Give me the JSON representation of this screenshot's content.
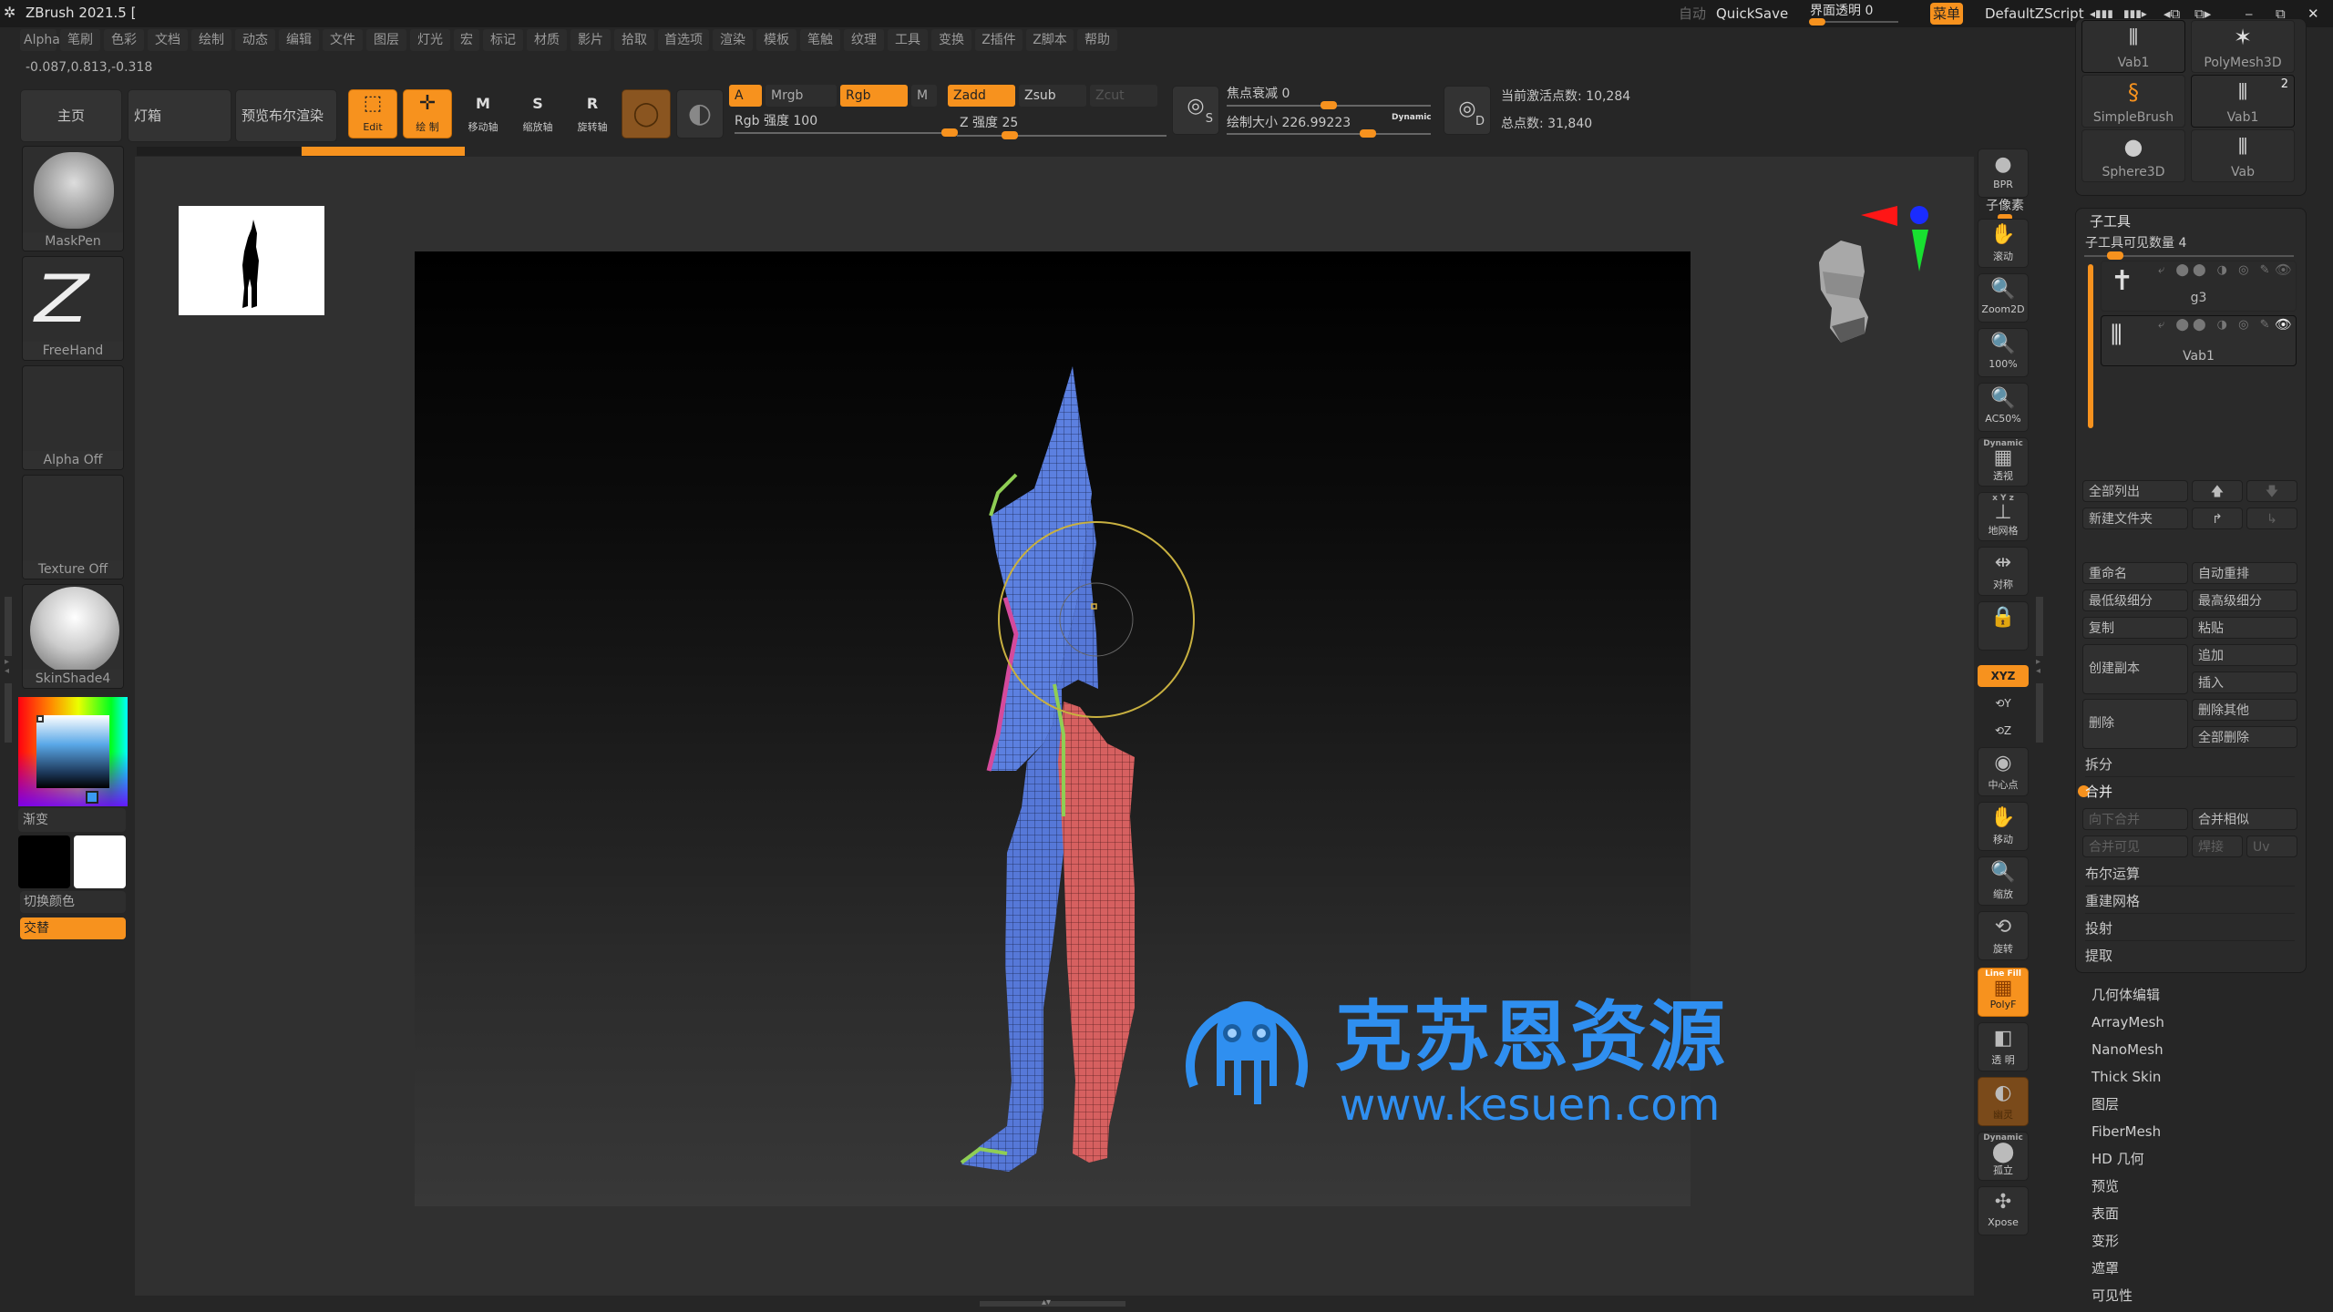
{
  "app": {
    "title": "ZBrush 2021.5 [",
    "auto_label": "自动",
    "quicksave": "QuickSave",
    "transparency_label": "界面透明 0",
    "menu_toggle": "菜单",
    "script_name": "DefaultZScript"
  },
  "menubar": [
    "Alpha",
    "笔刷",
    "色彩",
    "文档",
    "绘制",
    "动态",
    "编辑",
    "文件",
    "图层",
    "灯光",
    "宏",
    "标记",
    "材质",
    "影片",
    "拾取",
    "首选项",
    "渲染",
    "模板",
    "笔触",
    "纹理",
    "工具",
    "变换",
    "Z插件",
    "Z脚本",
    "帮助"
  ],
  "coords": "-0.087,0.813,-0.318",
  "toolbar": {
    "home": "主页",
    "lightbox": "灯箱",
    "bpr_preview": "预览布尔渲染",
    "edit": "Edit",
    "draw": "绘 制",
    "move": "移动轴",
    "scale": "缩放轴",
    "rotate": "旋转轴",
    "move_key": "M",
    "scale_key": "S",
    "rotate_key": "R",
    "a": "A",
    "mrgb": "Mrgb",
    "rgb": "Rgb",
    "m": "M",
    "zadd": "Zadd",
    "zsub": "Zsub",
    "zcut": "Zcut",
    "rgb_intensity": "Rgb 强度 100",
    "rgb_intensity_value": 100,
    "z_intensity": "Z 强度 25",
    "z_intensity_value": 25,
    "focal_shift": "焦点衰减 0",
    "focal_shift_value": 0,
    "draw_size": "绘制大小 226.99223",
    "draw_size_value": 226.99223,
    "dynamic": "Dynamic",
    "s_key": "S",
    "d_key": "D",
    "active_points": "当前激活点数: 10,284",
    "total_points": "总点数: 31,840"
  },
  "left_shelf": {
    "brush": "MaskPen",
    "stroke": "FreeHand",
    "alpha": "Alpha Off",
    "texture": "Texture Off",
    "material": "SkinShade4",
    "gradient": "渐变",
    "switch_color": "切换颜色",
    "alternate": "交替",
    "main_color": "#3a9af0"
  },
  "right_shelf": [
    {
      "name": "bpr",
      "label": "BPR"
    },
    {
      "name": "subpixel",
      "label": "子像素"
    },
    {
      "name": "scroll",
      "label": "滚动"
    },
    {
      "name": "zoom2d",
      "label": "Zoom2D"
    },
    {
      "name": "zoom100",
      "label": "100%"
    },
    {
      "name": "ac50",
      "label": "AC50%"
    },
    {
      "name": "perspective",
      "label": "透视",
      "sup": "Dynamic"
    },
    {
      "name": "floor",
      "label": "地网格",
      "sup": "x Y z"
    },
    {
      "name": "symmetry",
      "label": "对称"
    },
    {
      "name": "camera-lock",
      "label": ""
    },
    {
      "name": "xyz",
      "label": "XYZ"
    },
    {
      "name": "y",
      "label": "Y"
    },
    {
      "name": "z",
      "label": "Z"
    },
    {
      "name": "center",
      "label": "中心点"
    },
    {
      "name": "move",
      "label": "移动"
    },
    {
      "name": "zoom",
      "label": "缩放"
    },
    {
      "name": "rotate",
      "label": "旋转"
    },
    {
      "name": "polyf",
      "label": "PolyF",
      "sup": "Line Fill"
    },
    {
      "name": "transp",
      "label": "透 明"
    },
    {
      "name": "ghost",
      "label": "幽灵"
    },
    {
      "name": "solo",
      "label": "孤立",
      "sup": "Dynamic"
    },
    {
      "name": "xpose",
      "label": "Xpose"
    }
  ],
  "tool_palette": {
    "thumbs": [
      {
        "label": "Vab1"
      },
      {
        "label": "PolyMesh3D"
      },
      {
        "label": "SimpleBrush"
      },
      {
        "label": "Vab1",
        "badge": "2"
      },
      {
        "label": "Sphere3D"
      },
      {
        "label": "Vab"
      }
    ]
  },
  "subtool": {
    "title": "子工具",
    "visible_count": "子工具可见数量 4",
    "items": [
      {
        "name": "g3",
        "selected": false
      },
      {
        "name": "Vab1",
        "selected": true
      }
    ],
    "list_all": "全部列出",
    "new_folder": "新建文件夹",
    "rename": "重命名",
    "auto_reorder": "自动重排",
    "lowest_sub": "最低级细分",
    "highest_sub": "最高级细分",
    "copy": "复制",
    "paste": "粘贴",
    "duplicate": "创建副本",
    "append": "追加",
    "insert": "插入",
    "delete": "删除",
    "delete_other": "删除其他",
    "delete_all": "全部删除",
    "split": "拆分",
    "merge": "合并",
    "merge_down": "向下合并",
    "merge_similar": "合并相似",
    "merge_visible": "合并可见",
    "weld": "焊接",
    "uv": "Uv",
    "boolean": "布尔运算",
    "remesh": "重建网格",
    "project": "投射",
    "extract": "提取"
  },
  "tool_menu": [
    "几何体编辑",
    "ArrayMesh",
    "NanoMesh",
    "Thick Skin",
    "图层",
    "FiberMesh",
    "HD 几何",
    "预览",
    "表面",
    "变形",
    "遮罩",
    "可见性"
  ],
  "watermark": {
    "brand": "克苏恩资源",
    "url": "www.kesuen.com",
    "color": "#2f8ff0"
  },
  "accent_color": "#f7921e"
}
